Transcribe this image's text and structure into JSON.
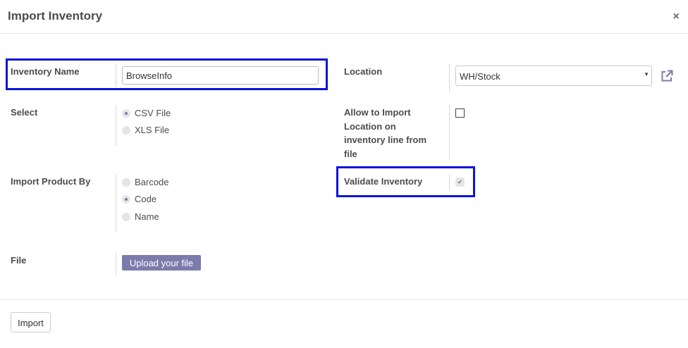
{
  "dialog": {
    "title": "Import Inventory",
    "close_icon": "×"
  },
  "fields": {
    "inventory_name": {
      "label": "Inventory Name",
      "value": "BrowseInfo"
    },
    "location": {
      "label": "Location",
      "value": "WH/Stock",
      "caret": "▼",
      "external_link_icon": "external-link-icon"
    },
    "select": {
      "label": "Select",
      "options": [
        {
          "label": "CSV File",
          "checked": true
        },
        {
          "label": "XLS File",
          "checked": false
        }
      ]
    },
    "allow_import_location": {
      "label_lines": [
        "Allow to Import",
        "Location on",
        "inventory line from",
        "file"
      ],
      "checked": false
    },
    "import_product_by": {
      "label": "Import Product By",
      "options": [
        {
          "label": "Barcode",
          "checked": false
        },
        {
          "label": "Code",
          "checked": true
        },
        {
          "label": "Name",
          "checked": false
        }
      ]
    },
    "validate_inventory": {
      "label": "Validate Inventory",
      "checked": true,
      "check_glyph": "✔"
    },
    "file": {
      "label": "File",
      "upload_label": "Upload your file"
    }
  },
  "footer": {
    "import_label": "Import"
  },
  "colors": {
    "highlight": "#0c14d8",
    "accent": "#7c7bad"
  }
}
